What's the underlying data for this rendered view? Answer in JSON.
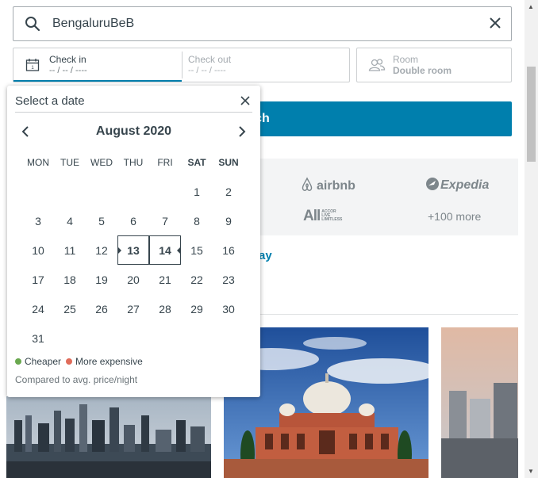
{
  "search": {
    "value": "BengaluruBeB"
  },
  "dates": {
    "check_in_label": "Check in",
    "check_in_value": "-- / -- / ----",
    "check_out_label": "Check out",
    "check_out_value": "-- / -- / ----"
  },
  "room": {
    "label": "Room",
    "value": "Double room"
  },
  "search_button": {
    "label_visible": "arch"
  },
  "partners": {
    "airbnb": "airbnb",
    "expedia": "Expedia",
    "all": "All",
    "all_small": "ACCOR LIVE LIMITLESS",
    "more": "+100 more"
  },
  "deals_fragment": "ay",
  "datepicker": {
    "title": "Select a date",
    "month": "August 2020",
    "weekdays": [
      "MON",
      "TUE",
      "WED",
      "THU",
      "FRI",
      "SAT",
      "SUN"
    ],
    "weeks": [
      [
        "",
        "",
        "",
        "",
        "",
        "1",
        "2"
      ],
      [
        "3",
        "4",
        "5",
        "6",
        "7",
        "8",
        "9"
      ],
      [
        "10",
        "11",
        "12",
        "13",
        "14",
        "15",
        "16"
      ],
      [
        "17",
        "18",
        "19",
        "20",
        "21",
        "22",
        "23"
      ],
      [
        "24",
        "25",
        "26",
        "27",
        "28",
        "29",
        "30"
      ],
      [
        "31",
        "",
        "",
        "",
        "",
        "",
        ""
      ]
    ],
    "selected_start": "13",
    "selected_end": "14",
    "legend_cheaper": "Cheaper",
    "legend_expensive": "More expensive",
    "compare_note": "Compared to avg. price/night",
    "colors": {
      "cheaper": "#6aa84f",
      "expensive": "#e06c5a"
    }
  },
  "colors": {
    "accent": "#007fad",
    "text": "#37454d"
  }
}
